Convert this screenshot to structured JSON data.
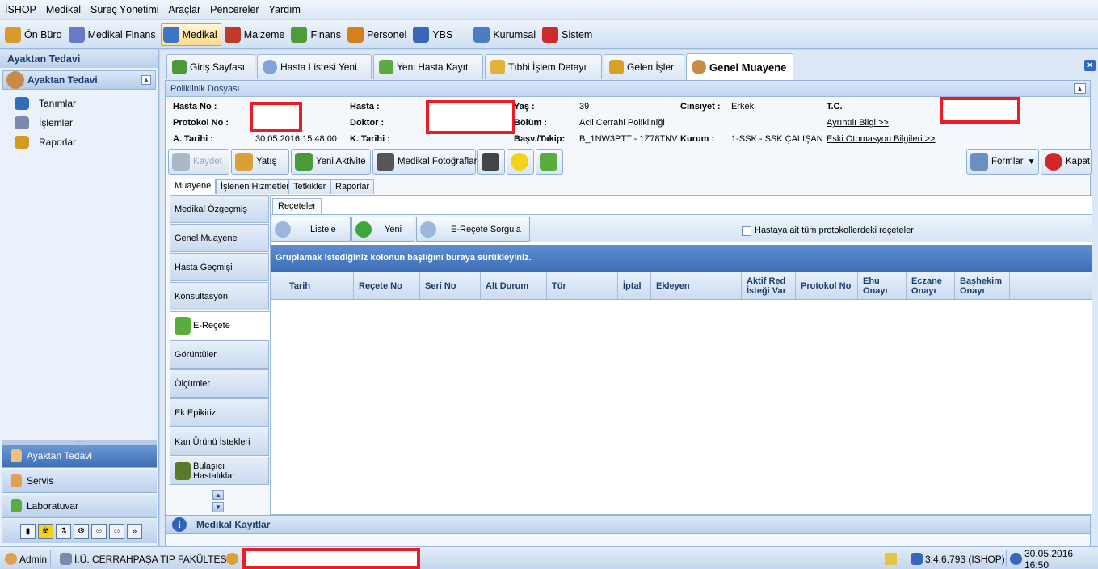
{
  "menu": [
    "İSHOP",
    "Medikal",
    "Süreç Yönetimi",
    "Araçlar",
    "Pencereler",
    "Yardım"
  ],
  "toolbar": [
    {
      "label": "Ön Büro",
      "icon": "front-office-icon",
      "color": "#d99a2b",
      "active": false
    },
    {
      "label": "Medikal Finans",
      "icon": "medical-finance-icon",
      "color": "#6a78c8",
      "active": false
    },
    {
      "label": "Medikal",
      "icon": "stethoscope-icon",
      "color": "#3c74c6",
      "active": true
    },
    {
      "label": "Malzeme",
      "icon": "pills-icon",
      "color": "#c0392b",
      "active": false
    },
    {
      "label": "Finans",
      "icon": "money-icon",
      "color": "#4d9b3a",
      "active": false
    },
    {
      "label": "Personel",
      "icon": "people-icon",
      "color": "#d5801d",
      "active": false
    },
    {
      "label": "YBS",
      "icon": "chart-icon",
      "color": "#3a66b8",
      "active": false
    },
    {
      "label": "Kurumsal",
      "icon": "building-icon",
      "color": "#4a7ec2",
      "active": false
    },
    {
      "label": "Sistem",
      "icon": "toolbox-icon",
      "color": "#cc2b2b",
      "active": false
    }
  ],
  "left": {
    "header": "Ayaktan Tedavi",
    "section": "Ayaktan Tedavi",
    "items": [
      {
        "label": "Tanımlar",
        "icon": "definitions-icon",
        "color": "#2f6fb5"
      },
      {
        "label": "İşlemler",
        "icon": "operations-icon",
        "color": "#7a8aa8"
      },
      {
        "label": "Raporlar",
        "icon": "reports-icon",
        "color": "#d49a20"
      }
    ],
    "nav": [
      {
        "label": "Ayaktan Tedavi",
        "selected": true,
        "icon": "doctor-icon"
      },
      {
        "label": "Servis",
        "selected": false,
        "icon": "nurse-icon"
      },
      {
        "label": "Laboratuvar",
        "selected": false,
        "icon": "flask-icon"
      }
    ]
  },
  "tabs": [
    {
      "label": "Giriş Sayfası",
      "icon": "home-icon",
      "color": "#4a9a3a",
      "selected": false
    },
    {
      "label": "Hasta Listesi Yeni",
      "icon": "magnifier-icon",
      "color": "#7da6d6",
      "selected": false
    },
    {
      "label": "Yeni Hasta Kayıt",
      "icon": "person-add-icon",
      "color": "#5aac3e",
      "selected": false
    },
    {
      "label": "Tıbbi İşlem Detayı",
      "icon": "envelope-icon",
      "color": "#e0b23a",
      "selected": false
    },
    {
      "label": "Gelen İşler",
      "icon": "inbox-icon",
      "color": "#d9a227",
      "selected": false
    },
    {
      "label": "Genel Muayene",
      "icon": "doctor-icon",
      "color": "#c98a4a",
      "selected": true
    }
  ],
  "patient": {
    "panel_title": "Poliklinik Dosyası",
    "labels": {
      "hasta_no": "Hasta No :",
      "protokol_no": "Protokol No :",
      "a_tarihi": "A. Tarihi :",
      "hasta": "Hasta :",
      "doktor": "Doktor :",
      "k_tarihi": "K. Tarihi :",
      "yas": "Yaş :",
      "bolum": "Bölüm :",
      "basv": "Başv./Takip:",
      "cinsiyet": "Cinsiyet :",
      "kurum": "Kurum :",
      "tc": "T.C."
    },
    "values": {
      "a_tarihi": "30.05.2016 15:48:00",
      "yas": "39",
      "bolum": "Acil Cerrahi Polikliniği",
      "basv": "B_1NW3PTT - 1Z78TNV",
      "cinsiyet": "Erkek",
      "kurum": "1-SSK - SSK ÇALIŞAN"
    },
    "links": {
      "detail": "Ayrıntılı Bilgi >>",
      "old": "Eski Otomasyon Bilgileri >>"
    }
  },
  "actions": {
    "kaydet": "Kaydet",
    "yatis": "Yatış",
    "aktivite": "Yeni Aktivite",
    "foto": "Medikal Fotoğraflar",
    "formlar": "Formlar",
    "kapat": "Kapat"
  },
  "subtabs": [
    "Muayene",
    "İşlenen Hizmetler",
    "Tetkikler",
    "Raporlar"
  ],
  "vtabs": [
    {
      "label": "Medikal Özgeçmiş",
      "selected": false
    },
    {
      "label": "Genel Muayene",
      "selected": false
    },
    {
      "label": "Hasta Geçmişi",
      "selected": false
    },
    {
      "label": "Konsultasyon",
      "selected": false
    },
    {
      "label": "E-Reçete",
      "selected": true
    },
    {
      "label": "Görüntüler",
      "selected": false
    },
    {
      "label": "Ölçümler",
      "selected": false
    },
    {
      "label": "Ek Epikiriz",
      "selected": false
    },
    {
      "label": "Kan Ürünü İstekleri",
      "selected": false
    },
    {
      "label": "Bulaşıcı Hastalıklar",
      "selected": false
    }
  ],
  "recete": {
    "tab": "Reçeteler",
    "buttons": {
      "listele": "Listele",
      "yeni": "Yeni",
      "sorgula": "E-Reçete Sorgula"
    },
    "checkbox": "Hastaya ait tüm protokollerdeki reçeteler",
    "group_hint": "Gruplamak istediğiniz kolonun başlığını buraya sürükleyiniz.",
    "columns": [
      "Tarih",
      "Reçete No",
      "Seri No",
      "Alt Durum",
      "Tür",
      "İptal",
      "Ekleyen",
      "Aktif Red İsteği Var",
      "Protokol No",
      "Ehu Onayı",
      "Eczane Onayı",
      "Başhekim Onayı"
    ]
  },
  "bottom_panel": "Medikal Kayıtlar",
  "status": {
    "user": "Admin",
    "org": "İ.Ü. CERRAHPAŞA TIP FAKÜLTESİ",
    "version": "3.4.6.793 (ISHOP)",
    "datetime": "30.05.2016 16:50"
  }
}
